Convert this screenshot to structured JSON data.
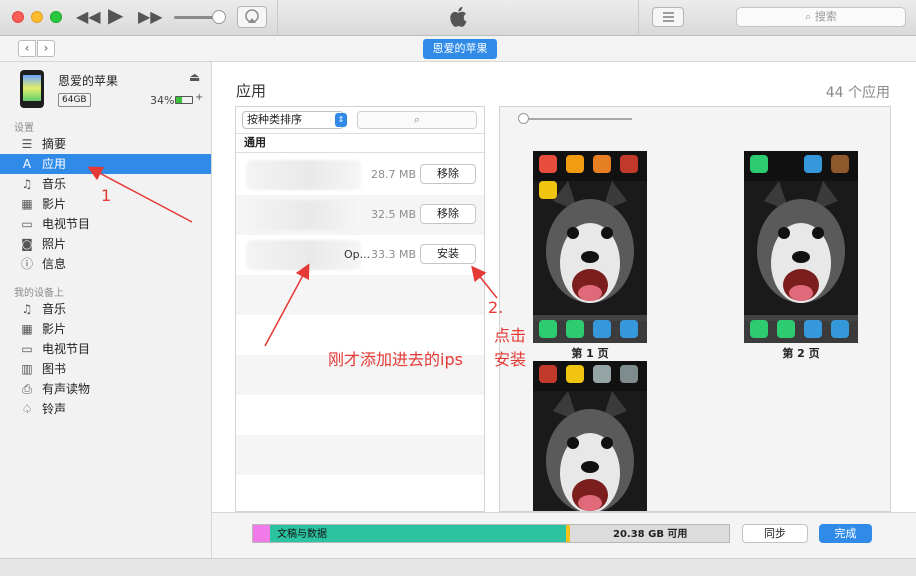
{
  "toolbar": {
    "search_placeholder": "搜索"
  },
  "navbar": {
    "device_pill": "恩爱的苹果"
  },
  "device": {
    "name": "恩爱的苹果",
    "capacity": "64GB",
    "battery": "34%"
  },
  "sidebar": {
    "settings_header": "设置",
    "settings_items": [
      {
        "label": "摘要",
        "icon": "list-icon",
        "glyph": "☰"
      },
      {
        "label": "应用",
        "icon": "app-store-icon",
        "glyph": "A",
        "selected": true
      },
      {
        "label": "音乐",
        "icon": "music-note-icon",
        "glyph": "♫"
      },
      {
        "label": "影片",
        "icon": "film-icon",
        "glyph": "▦"
      },
      {
        "label": "电视节目",
        "icon": "tv-icon",
        "glyph": "▭"
      },
      {
        "label": "照片",
        "icon": "camera-icon",
        "glyph": "◙"
      },
      {
        "label": "信息",
        "icon": "info-icon",
        "glyph": "ⓘ"
      }
    ],
    "on_device_header": "我的设备上",
    "on_device_items": [
      {
        "label": "音乐",
        "icon": "music-note-icon",
        "glyph": "♫"
      },
      {
        "label": "影片",
        "icon": "film-icon",
        "glyph": "▦"
      },
      {
        "label": "电视节目",
        "icon": "tv-icon",
        "glyph": "▭"
      },
      {
        "label": "图书",
        "icon": "book-icon",
        "glyph": "▥"
      },
      {
        "label": "有声读物",
        "icon": "audiobook-icon",
        "glyph": "⎙"
      },
      {
        "label": "铃声",
        "icon": "bell-icon",
        "glyph": "♤"
      }
    ]
  },
  "main": {
    "section_title": "应用",
    "app_count": "44 个应用",
    "sort_label": "按种类排序",
    "list_header": "通用",
    "apps": [
      {
        "name": "",
        "size": "28.7 MB",
        "action": "移除"
      },
      {
        "name": "",
        "size": "32.5 MB",
        "action": "移除"
      },
      {
        "name": "Op...",
        "size": "33.3 MB",
        "action": "安装"
      }
    ],
    "pages": [
      {
        "label": "第 1 页"
      },
      {
        "label": "第 2 页"
      },
      {
        "label": ""
      }
    ]
  },
  "storage": {
    "docs_label": "文稿与数据",
    "free_label": "20.38 GB 可用",
    "sync_label": "同步",
    "done_label": "完成",
    "colors": {
      "photos": "#f07ae8",
      "docs": "#2cc3a0",
      "other": "#f5c21b",
      "free": "#dcdcdc"
    }
  },
  "annotations": {
    "step1": "1",
    "step2_num": "2.",
    "step2_line1": "点击",
    "step2_line2": "安装",
    "note": "刚才添加进去的ips"
  }
}
